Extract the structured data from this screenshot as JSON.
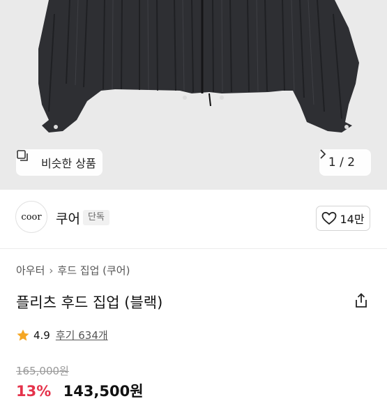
{
  "hero": {
    "similar_label": "비슷한 상품",
    "similar_icon": "stacked-square-icon",
    "pager": "1 / 2",
    "pager_icon": "chevron-right-icon"
  },
  "brand": {
    "logo_text": "coor",
    "name": "쿠어",
    "badge": "단독",
    "likes": "14만",
    "like_icon": "heart-outline-icon"
  },
  "breadcrumb": [
    "아우터",
    "후드 집업 (쿠어)"
  ],
  "product": {
    "title": "플리츠 후드 집업 (블랙)",
    "share_icon": "share-icon",
    "rating": "4.9",
    "reviews": "후기 634개",
    "star_color": "#f5a623",
    "original_price": "165,000원",
    "discount": "13%",
    "price": "143,500원",
    "discount_color": "#e5334b"
  }
}
